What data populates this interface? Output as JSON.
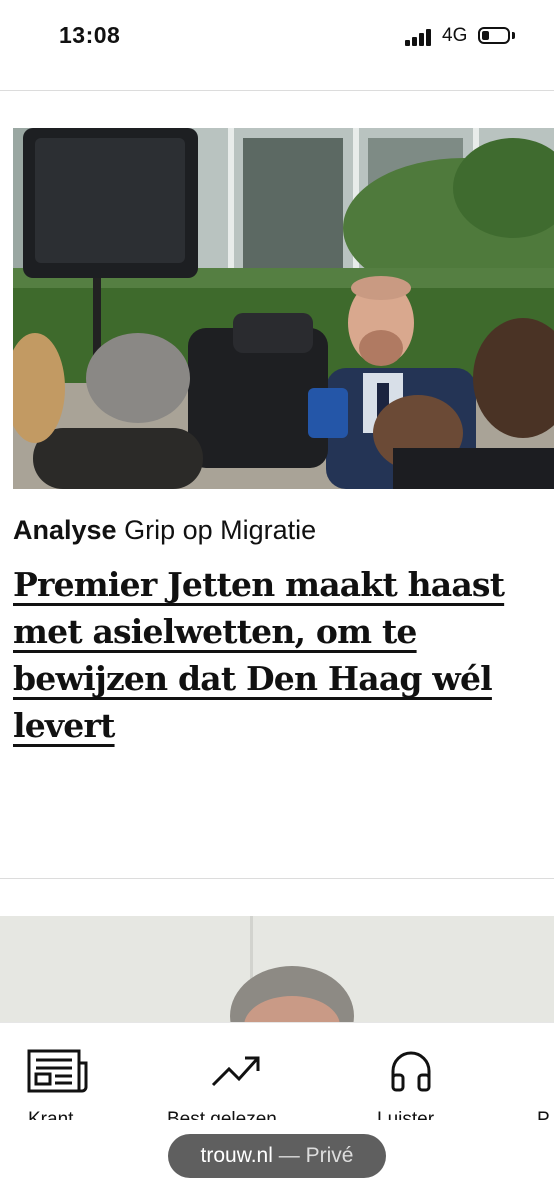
{
  "status_bar": {
    "time": "13:08",
    "network": "4G"
  },
  "article": {
    "kicker_label": "Analyse",
    "kicker_topic": "Grip op Migratie",
    "headline": "Premier Jetten maakt haast met asielwetten, om te bewijzen dat Den Haag wél levert"
  },
  "tabs": [
    {
      "label": "Krant",
      "icon": "newspaper-icon"
    },
    {
      "label": "Best gelezen",
      "icon": "trending-up-icon"
    },
    {
      "label": "Luister",
      "icon": "headphones-icon"
    },
    {
      "label": "P",
      "icon": ""
    }
  ],
  "browser": {
    "domain": "trouw.nl",
    "separator": "—",
    "mode": "Privé"
  }
}
